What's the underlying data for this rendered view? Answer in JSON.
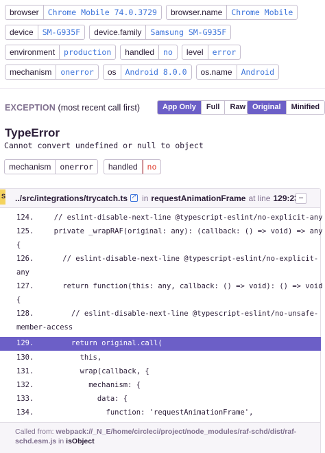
{
  "tags": [
    [
      {
        "key": "browser",
        "value": "Chrome Mobile 74.0.3729"
      },
      {
        "key": "browser.name",
        "value": "Chrome Mobile"
      }
    ],
    [
      {
        "key": "device",
        "value": "SM-G935F"
      },
      {
        "key": "device.family",
        "value": "Samsung SM-G935F"
      }
    ],
    [
      {
        "key": "environment",
        "value": "production"
      },
      {
        "key": "handled",
        "value": "no"
      },
      {
        "key": "level",
        "value": "error"
      }
    ],
    [
      {
        "key": "mechanism",
        "value": "onerror"
      },
      {
        "key": "os",
        "value": "Android 8.0.0"
      },
      {
        "key": "os.name",
        "value": "Android"
      }
    ]
  ],
  "exception": {
    "label": "EXCEPTION",
    "sublabel": "(most recent call first)",
    "buttons_view": [
      "App Only",
      "Full",
      "Raw"
    ],
    "buttons_order": [
      "Original",
      "Minified"
    ],
    "type": "TypeError",
    "message": "Cannot convert undefined or null to object",
    "mechanism": {
      "key": "mechanism",
      "value": "onerror"
    },
    "handled": {
      "key": "handled",
      "value": "no"
    }
  },
  "frame": {
    "badge": "S",
    "file": "../src/integrations/trycatch.ts",
    "in_label": "in",
    "function": "requestAnimationFrame",
    "at_line_label": "at line",
    "line_col": "129:23",
    "toggle": "–",
    "lines": [
      {
        "no": "124.",
        "code": "  // eslint-disable-next-line @typescript-eslint/no-explicit-any"
      },
      {
        "no": "125.",
        "code": "  private _wrapRAF(original: any): (callback: () => void) => any",
        "cont": "{"
      },
      {
        "no": "126.",
        "code": "    // eslint-disable-next-line @typescript-eslint/no-explicit-",
        "cont": "any"
      },
      {
        "no": "127.",
        "code": "    return function(this: any, callback: () => void): () => void",
        "cont": "{"
      },
      {
        "no": "128.",
        "code": "      // eslint-disable-next-line @typescript-eslint/no-unsafe-",
        "cont": "member-access"
      },
      {
        "no": "129.",
        "code": "      return original.call(",
        "active": true
      },
      {
        "no": "130.",
        "code": "        this,"
      },
      {
        "no": "131.",
        "code": "        wrap(callback, {"
      },
      {
        "no": "132.",
        "code": "          mechanism: {"
      },
      {
        "no": "133.",
        "code": "            data: {"
      },
      {
        "no": "134.",
        "code": "              function: 'requestAnimationFrame',"
      }
    ],
    "called_from_label": "Called from:",
    "called_from_path": "webpack://_N_E/home/circleci/project/node_modules/raf-schd/dist/raf-schd.esm.js",
    "called_from_in": "in",
    "called_from_fn": "isObject"
  }
}
